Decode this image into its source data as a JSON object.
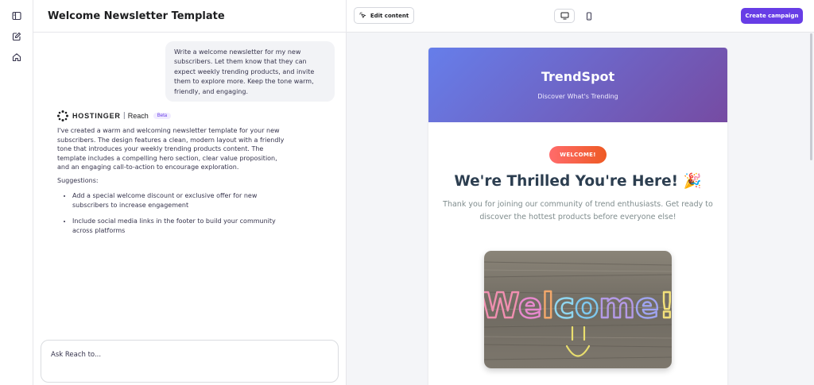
{
  "rail": {
    "icons": [
      "sidebar-toggle-icon",
      "edit-note-icon",
      "home-icon"
    ]
  },
  "chat": {
    "title": "Welcome Newsletter Template",
    "user_message": "Write a welcome newsletter for my new subscribers. Let them know that they can expect weekly trending products, and invite them to explore more. Keep the tone warm, friendly, and engaging.",
    "brand": {
      "name": "HOSTINGER",
      "separator": "|",
      "product": "Reach",
      "badge": "Beta"
    },
    "assistant_message": "I've created a warm and welcoming newsletter template for your new subscribers. The design features a clean, modern layout with a friendly tone that introduces your weekly trending products content. The template includes a compelling hero section, clear value proposition, and an engaging call-to-action to encourage exploration.",
    "suggestions_label": "Suggestions:",
    "suggestions": [
      "Add a special welcome discount or exclusive offer for new subscribers to increase engagement",
      "Include social media links in the footer to build your community across platforms"
    ],
    "input_placeholder": "Ask Reach to..."
  },
  "toolbar": {
    "edit_label": "Edit content",
    "devices": [
      "desktop-icon",
      "mobile-icon"
    ],
    "create_label": "Create campaign"
  },
  "newsletter": {
    "brand": "TrendSpot",
    "tagline": "Discover What's Trending",
    "badge": "WELCOME!",
    "headline": "We're Thrilled You're Here! 🎉",
    "intro": "Thank you for joining our community of trend enthusiasts. Get ready to discover the hottest products before everyone else!",
    "image_text": "Welcome!"
  },
  "colors": {
    "accent": "#673de6",
    "hero_gradient_start": "#667eea",
    "hero_gradient_end": "#764ba2",
    "badge_start": "#ff6b6b",
    "badge_end": "#ee5a24",
    "headline": "#2c3e50",
    "intro_text": "#7f8c8d"
  }
}
